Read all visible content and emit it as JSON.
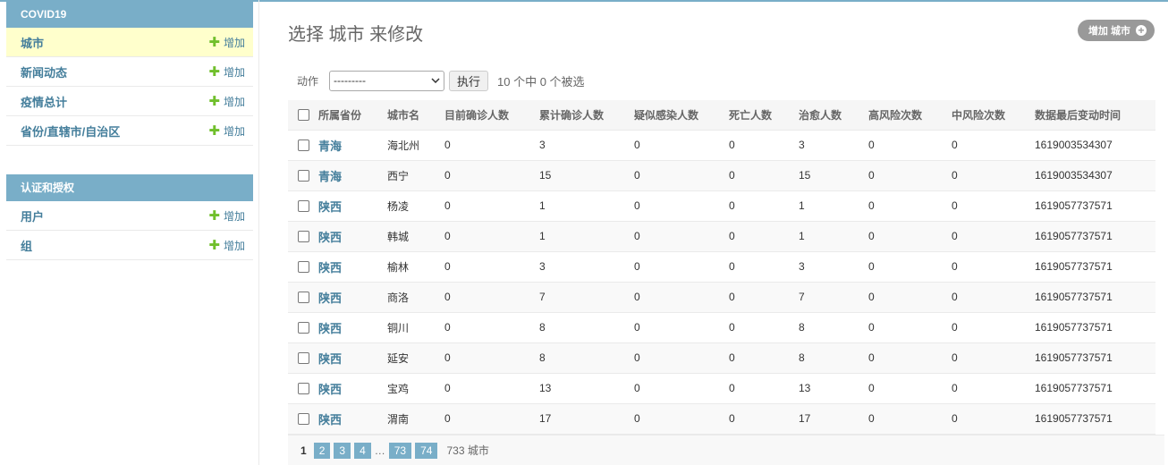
{
  "sidebar": {
    "modules": [
      {
        "caption": "COVID19",
        "items": [
          {
            "label": "城市",
            "add": "增加"
          },
          {
            "label": "新闻动态",
            "add": "增加"
          },
          {
            "label": "疫情总计",
            "add": "增加"
          },
          {
            "label": "省份/直辖市/自治区",
            "add": "增加"
          }
        ]
      },
      {
        "caption": "认证和授权",
        "items": [
          {
            "label": "用户",
            "add": "增加"
          },
          {
            "label": "组",
            "add": "增加"
          }
        ]
      }
    ]
  },
  "main": {
    "title": "选择 城市 来修改",
    "add_button": "增加 城市",
    "actions_label": "动作",
    "action_select": "---------",
    "execute": "执行",
    "selected_count": "10 个中 0 个被选",
    "columns": [
      "所属省份",
      "城市名",
      "目前确诊人数",
      "累计确诊人数",
      "疑似感染人数",
      "死亡人数",
      "治愈人数",
      "高风险次数",
      "中风险次数",
      "数据最后变动时间"
    ],
    "rows": [
      [
        "青海",
        "海北州",
        "0",
        "3",
        "0",
        "0",
        "3",
        "0",
        "0",
        "1619003534307"
      ],
      [
        "青海",
        "西宁",
        "0",
        "15",
        "0",
        "0",
        "15",
        "0",
        "0",
        "1619003534307"
      ],
      [
        "陕西",
        "杨凌",
        "0",
        "1",
        "0",
        "0",
        "1",
        "0",
        "0",
        "1619057737571"
      ],
      [
        "陕西",
        "韩城",
        "0",
        "1",
        "0",
        "0",
        "1",
        "0",
        "0",
        "1619057737571"
      ],
      [
        "陕西",
        "榆林",
        "0",
        "3",
        "0",
        "0",
        "3",
        "0",
        "0",
        "1619057737571"
      ],
      [
        "陕西",
        "商洛",
        "0",
        "7",
        "0",
        "0",
        "7",
        "0",
        "0",
        "1619057737571"
      ],
      [
        "陕西",
        "铜川",
        "0",
        "8",
        "0",
        "0",
        "8",
        "0",
        "0",
        "1619057737571"
      ],
      [
        "陕西",
        "延安",
        "0",
        "8",
        "0",
        "0",
        "8",
        "0",
        "0",
        "1619057737571"
      ],
      [
        "陕西",
        "宝鸡",
        "0",
        "13",
        "0",
        "0",
        "13",
        "0",
        "0",
        "1619057737571"
      ],
      [
        "陕西",
        "渭南",
        "0",
        "17",
        "0",
        "0",
        "17",
        "0",
        "0",
        "1619057737571"
      ]
    ],
    "pagination": {
      "current": "1",
      "pages": [
        "2",
        "3",
        "4"
      ],
      "ellipsis": "…",
      "tail_pages": [
        "73",
        "74"
      ],
      "total": "733 城市"
    }
  },
  "colors": {
    "module_header": "#79aec8",
    "link": "#447e9b",
    "add_plus": "#70bf2b",
    "current_row": "#ffffcc"
  },
  "icons": {
    "add": "plus-icon",
    "select": "chevron-down-icon"
  }
}
